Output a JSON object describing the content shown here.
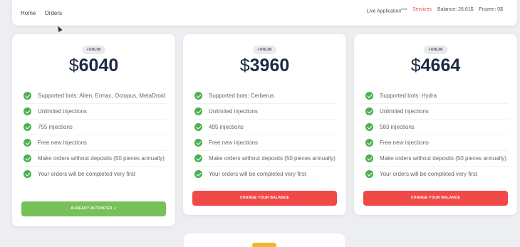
{
  "nav": {
    "home": "Home",
    "orders": "Orders",
    "live": "Live Application",
    "live_sup": "beta",
    "services": "Services",
    "balance": "Balance: 26.61$",
    "frozen": "Frozen: 0$"
  },
  "colors": {
    "accent_red": "#ef4a48",
    "accent_green": "#78c05a",
    "check_green": "#4caf50"
  },
  "plans": [
    {
      "badge": "+UNLIM",
      "currency": "$",
      "amount": "6040",
      "features": [
        "Supported bots: Alien, Ermac, Octopus, MetaDroid",
        "Unlimited injections",
        "755 injections",
        "Free new injections",
        "Make orders without deposits (50 pieces annually)",
        "Your orders will be completed very first"
      ],
      "button": "ALREADY ACTIVATED ✓"
    },
    {
      "badge": "+UNLIM",
      "currency": "$",
      "amount": "3960",
      "features": [
        "Supported bots: Cerberus",
        "Unlimited injections",
        "495 injections",
        "Free new injections",
        "Make orders without deposits (50 pieces annually)",
        "Your orders will be completed very first"
      ],
      "button": "CHARGE YOUR BALANCE"
    },
    {
      "badge": "+UNLIM",
      "currency": "$",
      "amount": "4664",
      "features": [
        "Supported bots: Hydra",
        "Unlimited injections",
        "583 injections",
        "Free new injections",
        "Make orders without deposits (50 pieces annually)",
        "Your orders will be completed very first"
      ],
      "button": "CHARGE YOUR BALANCE"
    }
  ]
}
